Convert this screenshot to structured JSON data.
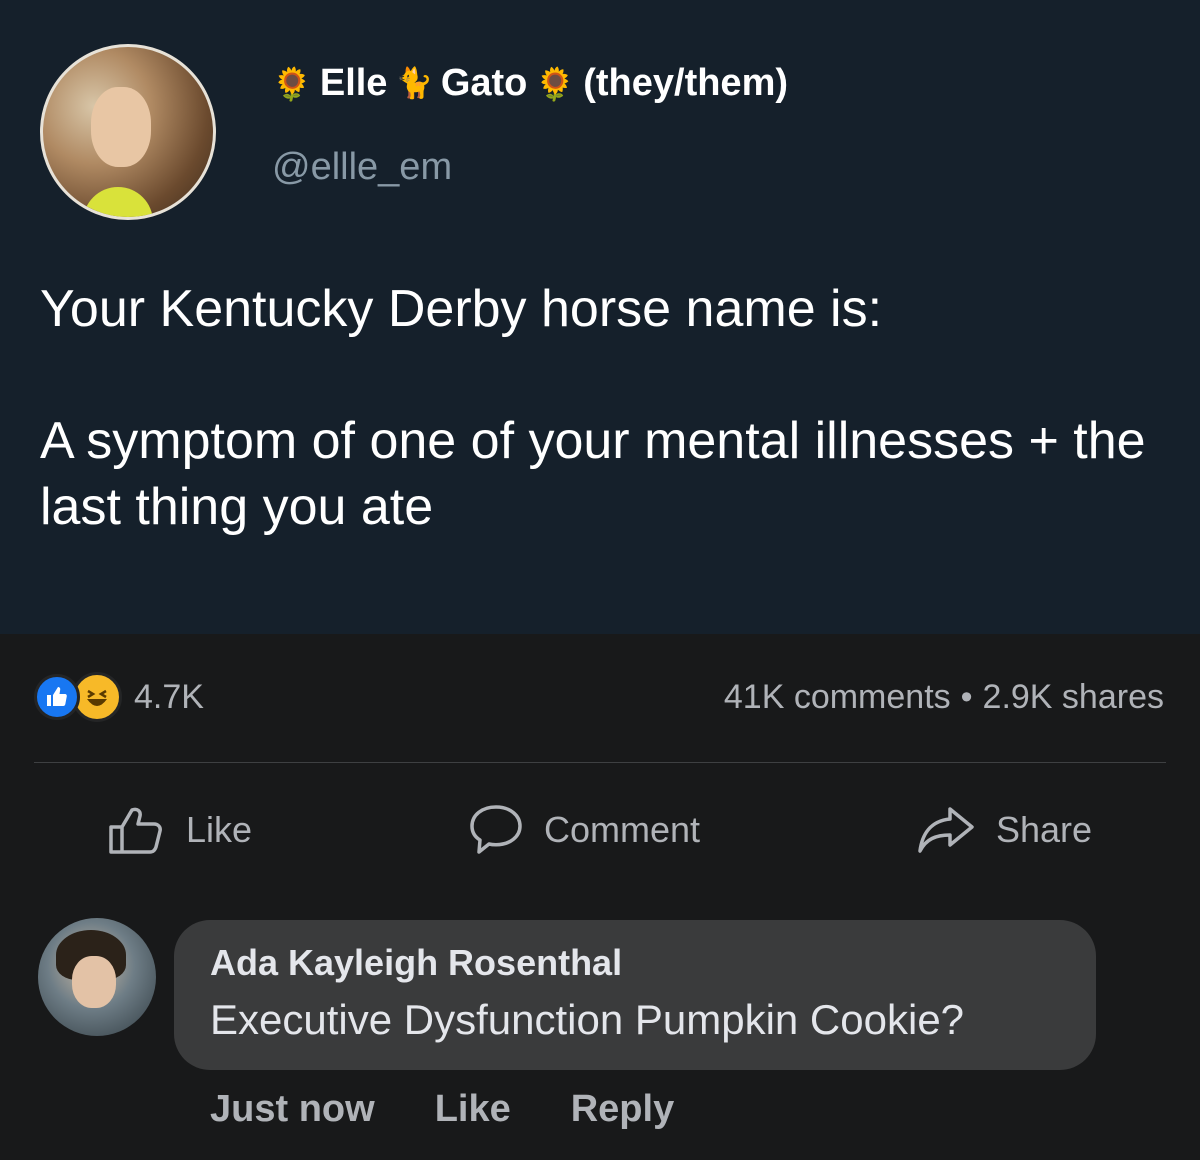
{
  "tweet": {
    "display_name": "Elle",
    "name_mid": "Gato",
    "pronouns": "(they/them)",
    "handle": "@ellle_em",
    "text_line1": "Your Kentucky Derby horse name is:",
    "text_line2": "A symptom of one of your mental illnesses + the last thing you ate",
    "bg_color": "#15202b"
  },
  "reactions": {
    "count": "4.7K",
    "types": [
      "like",
      "haha"
    ]
  },
  "stats": {
    "comments": "41K comments",
    "separator": "•",
    "shares": "2.9K shares"
  },
  "actions": {
    "like": "Like",
    "comment": "Comment",
    "share": "Share"
  },
  "comment": {
    "author": "Ada Kayleigh Rosenthal",
    "text": "Executive Dysfunction Pumpkin Cookie?",
    "time": "Just now",
    "like": "Like",
    "reply": "Reply"
  },
  "colors": {
    "page_bg": "#18191a",
    "bubble_bg": "#3a3b3c",
    "like_blue": "#1877f2",
    "haha_yellow": "#f7b928"
  }
}
